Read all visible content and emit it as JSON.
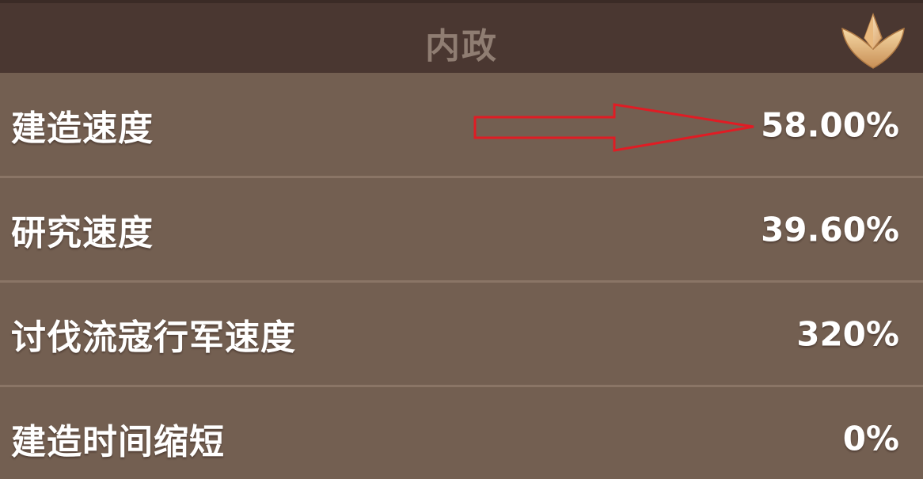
{
  "header": {
    "title": "内政",
    "icon": "gold-crest-icon"
  },
  "stats": [
    {
      "label": "建造速度",
      "value": "58.00%"
    },
    {
      "label": "研究速度",
      "value": "39.60%"
    },
    {
      "label": "讨伐流寇行军速度",
      "value": "320%"
    },
    {
      "label": "建造时间缩短",
      "value": "0%"
    }
  ],
  "annotation": {
    "icon": "red-arrow-icon",
    "color": "#e01c24"
  },
  "colors": {
    "header_bg": "#4a3731",
    "panel_bg": "#735f51",
    "divider": "#8a7566",
    "title_text": "#8f7d72",
    "value_text": "#ffffff"
  }
}
